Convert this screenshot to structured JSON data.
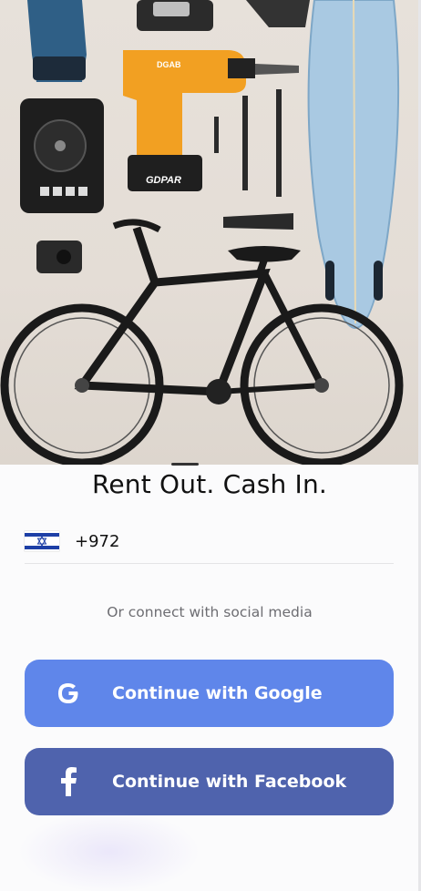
{
  "hero": {
    "drill_brand": "DGAB",
    "battery_brand": "GDPAR"
  },
  "title": "Rent Out. Cash In.",
  "phone": {
    "country": "Israel",
    "dial_code": "+972",
    "flag_icon": "israel-flag-icon"
  },
  "social": {
    "caption": "Or connect with social media",
    "google_label": "Continue with Google",
    "facebook_label": "Continue with Facebook"
  },
  "colors": {
    "google_button": "#5f86ea",
    "facebook_button": "#4f63ad",
    "flag_blue": "#1d3fa6"
  }
}
